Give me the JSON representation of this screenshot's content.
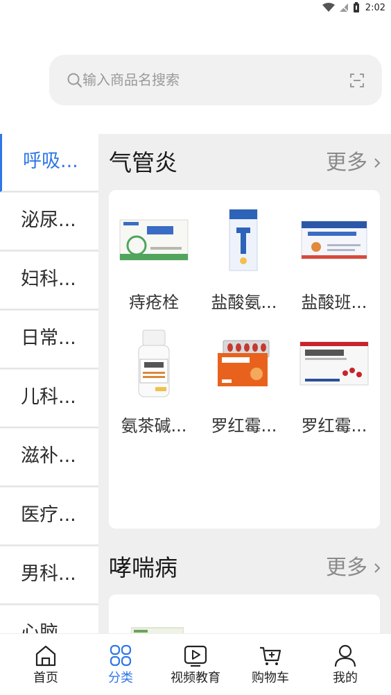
{
  "status_bar": {
    "time": "2:02"
  },
  "search": {
    "placeholder": "输入商品名搜索"
  },
  "sidebar": {
    "items": [
      {
        "label": "呼吸...",
        "active": true
      },
      {
        "label": "泌尿..."
      },
      {
        "label": "妇科..."
      },
      {
        "label": "日常..."
      },
      {
        "label": "儿科..."
      },
      {
        "label": "滋补..."
      },
      {
        "label": "医疗..."
      },
      {
        "label": "男科..."
      },
      {
        "label": "心脑..."
      }
    ]
  },
  "sections": [
    {
      "title": "气管炎",
      "more_label": "更多",
      "products": [
        {
          "name": "痔疮栓"
        },
        {
          "name": "盐酸氨..."
        },
        {
          "name": "盐酸班..."
        },
        {
          "name": "氨茶碱..."
        },
        {
          "name": "罗红霉..."
        },
        {
          "name": "罗红霉..."
        }
      ]
    },
    {
      "title": "哮喘病",
      "more_label": "更多",
      "products": []
    }
  ],
  "bottom_nav": {
    "items": [
      {
        "label": "首页",
        "icon": "home-icon"
      },
      {
        "label": "分类",
        "icon": "category-icon",
        "active": true
      },
      {
        "label": "视频教育",
        "icon": "video-icon"
      },
      {
        "label": "购物车",
        "icon": "cart-icon"
      },
      {
        "label": "我的",
        "icon": "profile-icon"
      }
    ]
  },
  "colors": {
    "accent": "#2f77e6",
    "background": "#efefef",
    "text": "#222222"
  }
}
